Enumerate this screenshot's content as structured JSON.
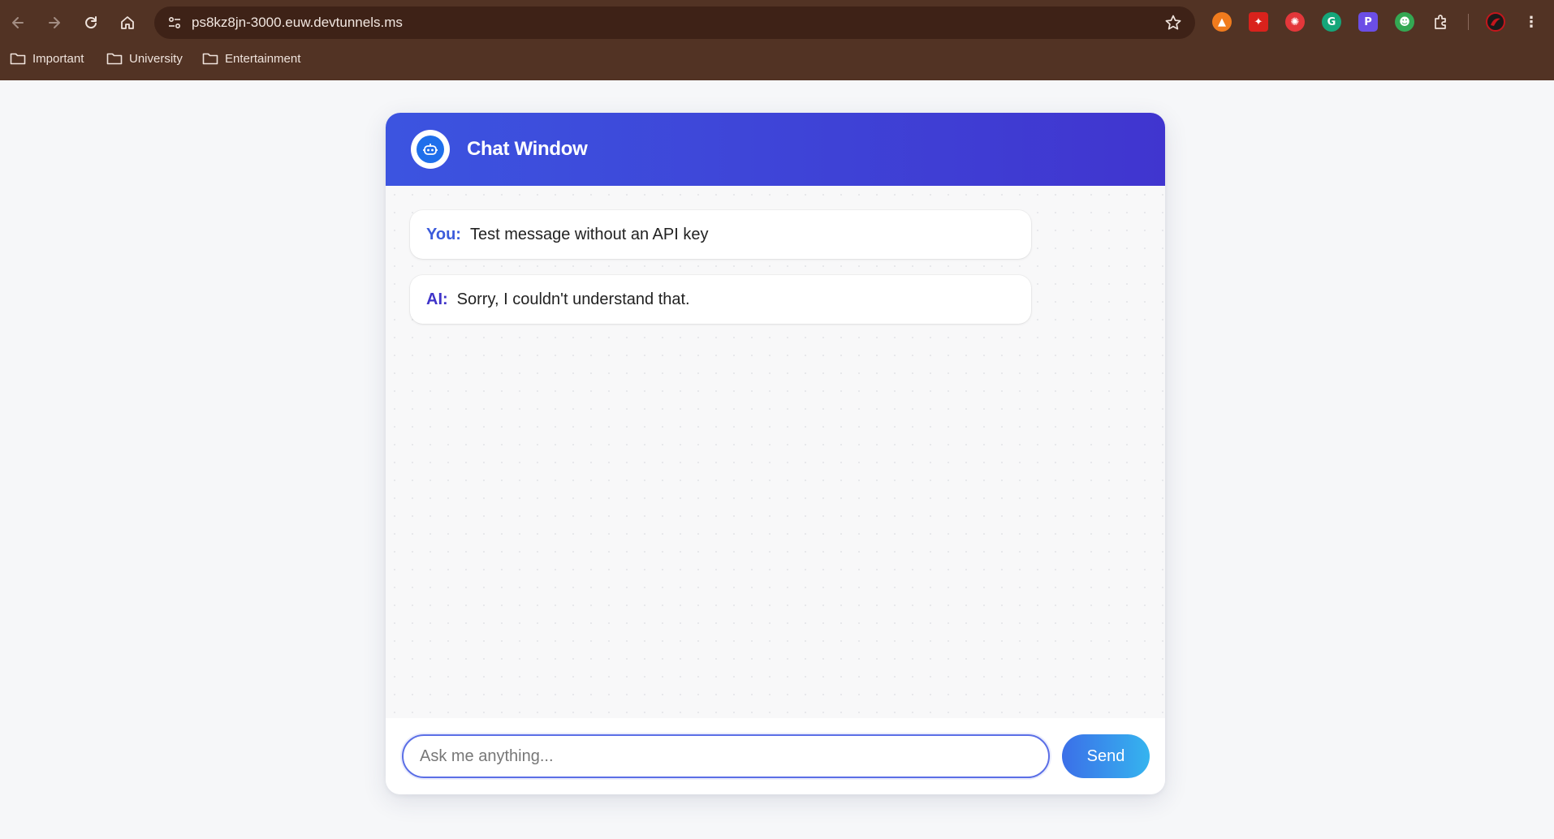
{
  "browser": {
    "url": "ps8kz8jn-3000.euw.devtunnels.ms",
    "bookmarks": [
      "Important",
      "University",
      "Entertainment"
    ],
    "extensions": [
      {
        "icon": "orange-triangle-extension-icon",
        "color": "#f07b1d"
      },
      {
        "icon": "pdf-extension-icon",
        "color": "#d9221c"
      },
      {
        "icon": "red-circle-extension-icon",
        "color": "#e3373a"
      },
      {
        "icon": "grammarly-extension-icon",
        "color": "#15a67a"
      },
      {
        "icon": "purple-p-extension-icon",
        "color": "#6b4ee6"
      },
      {
        "icon": "green-robot-extension-icon",
        "color": "#34a853"
      },
      {
        "icon": "puzzle-extensions-icon",
        "color": "#e8d8cf"
      }
    ],
    "chrome_color": "#523324",
    "omnibox_color": "#3e2217"
  },
  "chat": {
    "title": "Chat Window",
    "messages": [
      {
        "sender": "You:",
        "text": "Test message without an API key"
      },
      {
        "sender": "AI:",
        "text": "Sorry, I couldn't understand that."
      }
    ],
    "input": {
      "placeholder": "Ask me anything...",
      "value": ""
    },
    "send_label": "Send",
    "colors": {
      "header_start": "#3c54e0",
      "header_end": "#4035cf",
      "send_start": "#3b6fe8",
      "send_end": "#35b4ef"
    }
  }
}
